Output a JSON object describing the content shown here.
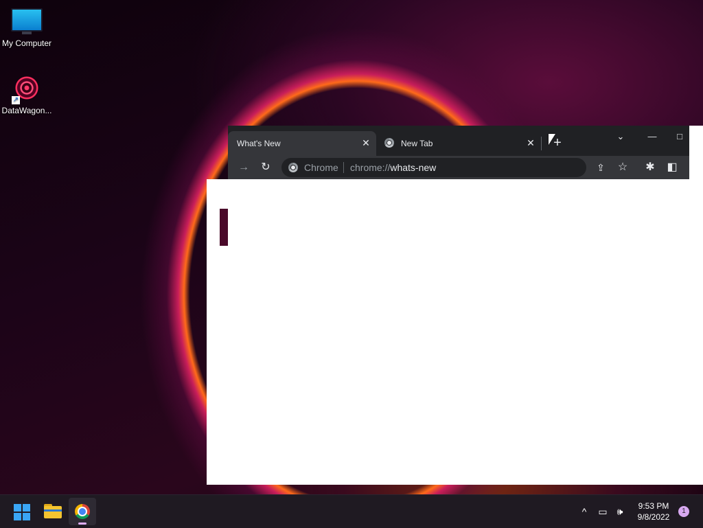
{
  "desktop": {
    "icons": [
      {
        "label": "My Computer"
      },
      {
        "label": "DataWagon..."
      }
    ]
  },
  "browser": {
    "tabs": [
      {
        "title": "What's New",
        "active": true
      },
      {
        "title": "New Tab",
        "active": false
      }
    ],
    "close_glyph": "✕",
    "new_tab_glyph": "+",
    "tab_search_glyph": "⌄",
    "minimize_glyph": "—",
    "maximize_glyph": "□",
    "toolbar": {
      "forward_glyph": "→",
      "reload_glyph": "↻",
      "chip_label": "Chrome",
      "url_scheme": "chrome://",
      "url_host": "whats-new",
      "share_glyph": "⇪",
      "bookmark_glyph": "☆",
      "extensions_glyph": "✱",
      "side_panel_glyph": "◧"
    }
  },
  "taskbar": {
    "tray": {
      "chevron_glyph": "^",
      "network_glyph": "▭",
      "volume_glyph": "🕪"
    },
    "time": "9:53 PM",
    "date": "9/8/2022",
    "notification_count": "1"
  },
  "colors": {
    "accent": "#3aa6f5",
    "chrome_dark": "#202124",
    "chrome_tab": "#35363a"
  }
}
